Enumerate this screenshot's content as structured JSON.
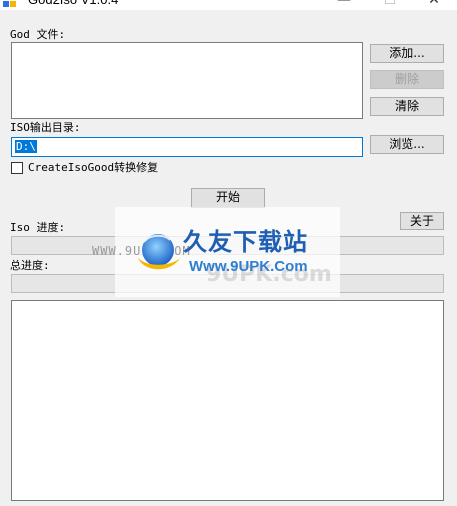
{
  "window": {
    "title": "God2Iso V1.0.4",
    "minimize": "—",
    "maximize": "☐",
    "close": "✕"
  },
  "god_files": {
    "label": "God 文件:",
    "add_label": "添加...",
    "delete_label": "删除",
    "clear_label": "清除"
  },
  "iso_output": {
    "label": "ISO输出目录:",
    "value": "D:\\",
    "browse_label": "浏览..."
  },
  "repair_option": {
    "label": "CreateIsoGood转换修复",
    "checked": false
  },
  "start_label": "开始",
  "about_label": "关于",
  "iso_progress": {
    "label": "Iso 进度:",
    "value": 0
  },
  "total_progress": {
    "label": "总进度:",
    "value": 0
  },
  "log": {
    "content": ""
  },
  "watermark": {
    "url": "WWW.9UPK.COM",
    "brand": "久友下载站",
    "site": "Www.9UPK.Com",
    "faint": "9UPK.com"
  },
  "colors": {
    "accent": "#0078d7",
    "brand_blue": "#1e5fb3",
    "logo_yellow": "#f5b800"
  }
}
